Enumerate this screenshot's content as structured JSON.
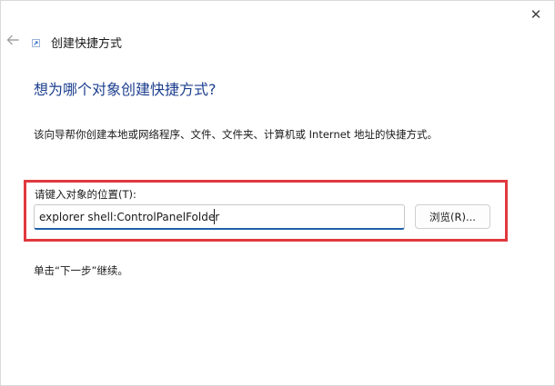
{
  "window": {
    "title": "创建快捷方式",
    "close_glyph": "✕"
  },
  "wizard": {
    "heading": "想为哪个对象创建快捷方式?",
    "description": "该向导帮你创建本地或网络程序、文件、文件夹、计算机或 Internet 地址的快捷方式。",
    "location_label": "请键入对象的位置(T):",
    "location_value": "explorer shell:ControlPanelFolder",
    "browse_label": "浏览(R)...",
    "hint": "单击“下一步”继续。"
  },
  "colors": {
    "heading": "#1d3f8f",
    "highlight_box": "#e0393e",
    "input_underline": "#1f5fa8"
  },
  "icons": {
    "back": "back-arrow-icon",
    "title": "shortcut-icon",
    "close": "close-icon"
  }
}
